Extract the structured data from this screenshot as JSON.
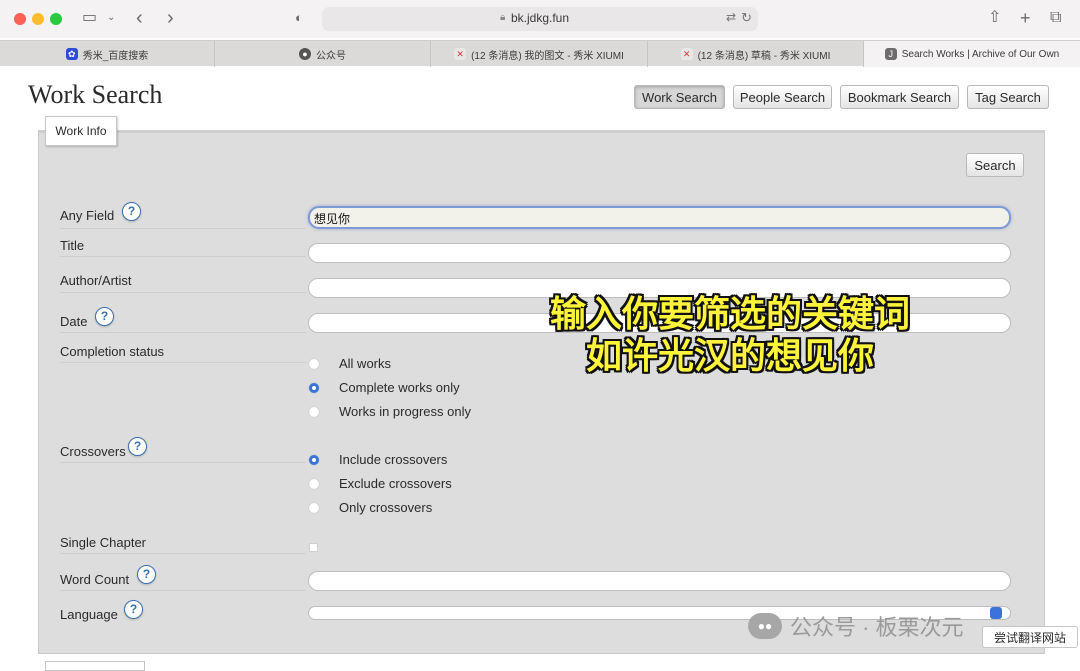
{
  "browser": {
    "url": "bk.jdkg.fun",
    "tabs": [
      {
        "label": "秀米_百度搜索",
        "icon": "baidu-paw-icon",
        "active": false
      },
      {
        "label": "公众号",
        "icon": "wechat-icon",
        "active": false
      },
      {
        "label": "(12 条消息) 我的图文 - 秀米 XIUMI",
        "icon": "xiumi-icon",
        "active": false
      },
      {
        "label": "(12 条消息) 草稿 - 秀米 XIUMI",
        "icon": "xiumi-icon",
        "active": false
      },
      {
        "label": "Search Works | Archive of Our Own",
        "icon": "ao3-icon",
        "active": true
      }
    ]
  },
  "page": {
    "title": "Work Search",
    "nav": [
      "Work Search",
      "People Search",
      "Bookmark Search",
      "Tag Search"
    ],
    "nav_active": "Work Search",
    "fieldset_legend": "Work Info",
    "search_button": "Search",
    "help_glyph": "?"
  },
  "form": {
    "any_field": {
      "label": "Any Field",
      "value": "想见你"
    },
    "title": {
      "label": "Title",
      "value": ""
    },
    "author": {
      "label": "Author/Artist",
      "value": ""
    },
    "date": {
      "label": "Date",
      "value": ""
    },
    "completion": {
      "label": "Completion status",
      "options": [
        "All works",
        "Complete works only",
        "Works in progress only"
      ],
      "selected": "Complete works only"
    },
    "crossovers": {
      "label": "Crossovers",
      "options": [
        "Include crossovers",
        "Exclude crossovers",
        "Only crossovers"
      ],
      "selected": "Include crossovers"
    },
    "single_chapter": {
      "label": "Single Chapter",
      "checked": false
    },
    "word_count": {
      "label": "Word Count",
      "value": ""
    },
    "language": {
      "label": "Language",
      "value": ""
    }
  },
  "overlay": {
    "caption_line1": "输入你要筛选的关键词",
    "caption_line2": "如许光汉的想见你",
    "watermark": "公众号 · 板栗次元",
    "translate_hint": "尝试翻译网站"
  },
  "colors": {
    "caption": "#fdf33a",
    "radio_selected": "#3a73d9",
    "panel_bg": "#dddddd"
  }
}
